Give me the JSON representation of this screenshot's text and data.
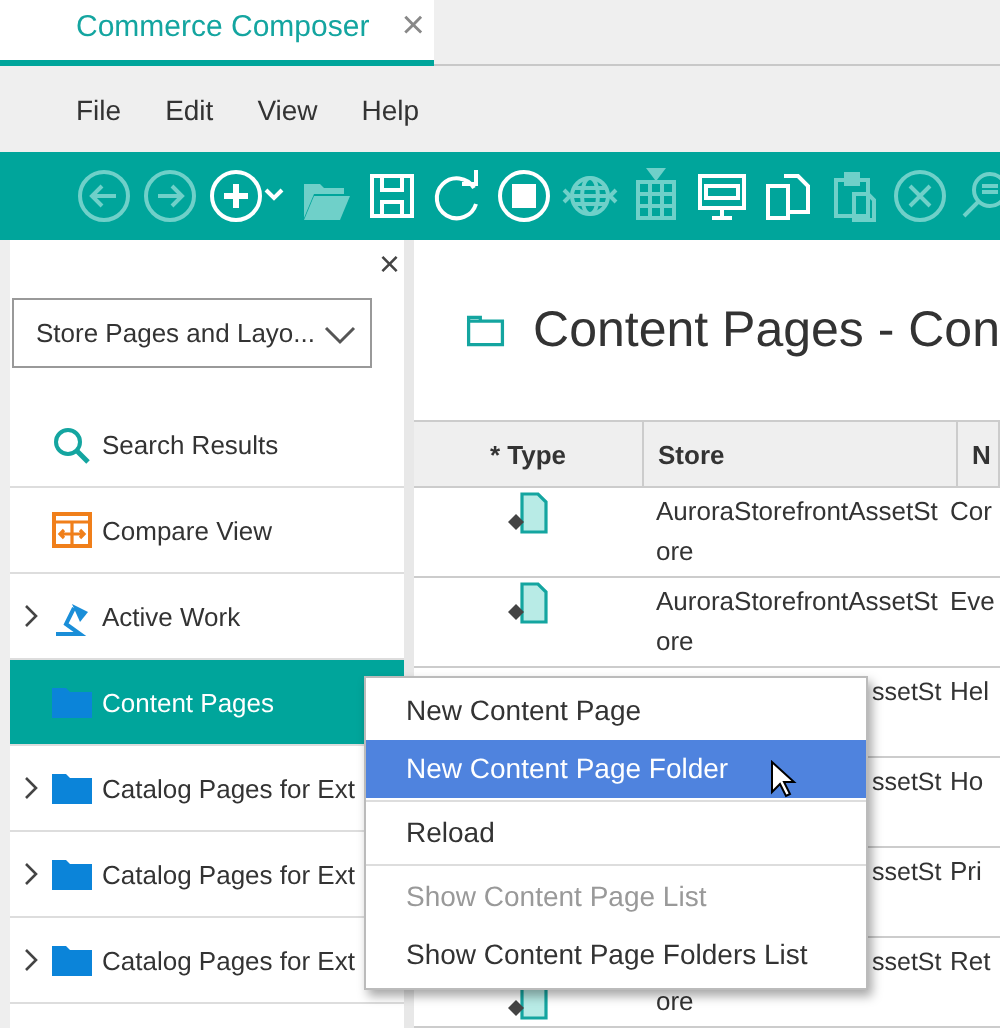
{
  "tab": {
    "title": "Commerce Composer",
    "close": "×",
    "selected": true
  },
  "menu_bar": [
    "File",
    "Edit",
    "View",
    "Help"
  ],
  "toolbar": [
    {
      "kind": "back",
      "disabled": true
    },
    {
      "kind": "forward",
      "disabled": true
    },
    {
      "kind": "add",
      "disabled": false
    },
    {
      "kind": "folder",
      "disabled": true
    },
    {
      "kind": "save",
      "disabled": false
    },
    {
      "kind": "refresh",
      "disabled": false
    },
    {
      "kind": "stop",
      "disabled": false
    },
    {
      "kind": "globe",
      "disabled": true
    },
    {
      "kind": "grid",
      "disabled": true
    },
    {
      "kind": "monitor",
      "disabled": false
    },
    {
      "kind": "copy",
      "disabled": false
    },
    {
      "kind": "paste",
      "disabled": true
    },
    {
      "kind": "cancel",
      "disabled": true
    },
    {
      "kind": "find",
      "disabled": true
    }
  ],
  "sidebar": {
    "close": "×",
    "dropdown": "Store Pages and Layo...",
    "items": [
      {
        "label": "Search Results",
        "kind": "search",
        "expandable": false,
        "selected": false
      },
      {
        "label": "Compare View",
        "kind": "compare",
        "expandable": false,
        "selected": false
      },
      {
        "label": "Active Work",
        "kind": "lamp",
        "expandable": true,
        "selected": false
      },
      {
        "label": "Content Pages",
        "kind": "folder",
        "expandable": false,
        "selected": true
      },
      {
        "label": "Catalog Pages for Ext",
        "kind": "folder",
        "expandable": true,
        "selected": false
      },
      {
        "label": "Catalog Pages for Ext",
        "kind": "folder",
        "expandable": true,
        "selected": false
      },
      {
        "label": "Catalog Pages for Ext",
        "kind": "folder",
        "expandable": true,
        "selected": false
      }
    ]
  },
  "content": {
    "title": "Content Pages - Con",
    "table": {
      "columns": [
        "* Type",
        "Store",
        "N"
      ],
      "rows": [
        {
          "type_icon": true,
          "covered": false,
          "store": [
            "AuroraStorefrontAssetSt",
            "ore"
          ],
          "column_3": "Cor"
        },
        {
          "type_icon": true,
          "covered": false,
          "store": [
            "AuroraStorefrontAssetSt",
            "ore"
          ],
          "column_3": "Eve"
        },
        {
          "type_icon": false,
          "covered": true,
          "store": [
            "ssetSt"
          ],
          "column_3": "Hel"
        },
        {
          "type_icon": false,
          "covered": true,
          "store": [
            "ssetSt"
          ],
          "column_3": "Ho"
        },
        {
          "type_icon": false,
          "covered": true,
          "store": [
            "ssetSt"
          ],
          "column_3": "Pri"
        },
        {
          "type_icon": true,
          "covered": true,
          "store": [
            "ssetSt",
            "ore"
          ],
          "column_3": "Ret"
        }
      ]
    }
  },
  "context_menu": [
    {
      "label": "New Content Page",
      "selected": false,
      "disabled": false,
      "separator_after": false
    },
    {
      "label": "New Content Page Folder",
      "selected": true,
      "disabled": false,
      "separator_after": true
    },
    {
      "label": "Reload",
      "selected": false,
      "disabled": false,
      "separator_after": true
    },
    {
      "label": "Show Content Page List",
      "selected": false,
      "disabled": true,
      "separator_after": false
    },
    {
      "label": "Show Content Page Folders List",
      "selected": false,
      "disabled": false,
      "separator_after": false
    }
  ]
}
